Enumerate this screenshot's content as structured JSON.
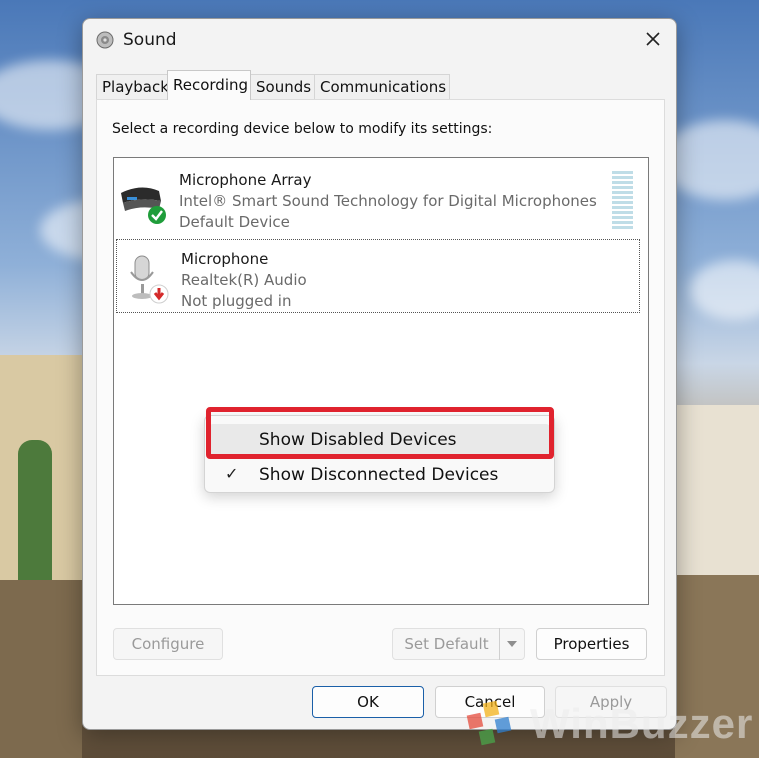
{
  "window": {
    "title": "Sound",
    "close_label": "Close"
  },
  "tabs": [
    {
      "label": "Playback"
    },
    {
      "label": "Recording"
    },
    {
      "label": "Sounds"
    },
    {
      "label": "Communications"
    }
  ],
  "instruction": "Select a recording device below to modify its settings:",
  "devices": [
    {
      "name": "Microphone Array",
      "driver": "Intel® Smart Sound Technology for Digital Microphones",
      "status": "Default Device",
      "icon": "microphone-array-icon",
      "badge": "green-check"
    },
    {
      "name": "Microphone",
      "driver": "Realtek(R) Audio",
      "status": "Not plugged in",
      "icon": "microphone-icon",
      "badge": "red-down-arrow"
    }
  ],
  "context_menu": {
    "items": [
      {
        "label": "Show Disabled Devices",
        "checked": false
      },
      {
        "label": "Show Disconnected Devices",
        "checked": true
      }
    ],
    "check_glyph": "✓"
  },
  "buttons": {
    "configure": "Configure",
    "set_default": "Set Default",
    "properties": "Properties",
    "ok": "OK",
    "cancel": "Cancel",
    "apply": "Apply"
  },
  "watermark": {
    "text": "WinBuzzer"
  },
  "colors": {
    "highlight": "#e0232e",
    "ok_border": "#1a5fa8",
    "default_badge": "#1f9d3a",
    "unplugged_badge": "#d42a2a"
  }
}
